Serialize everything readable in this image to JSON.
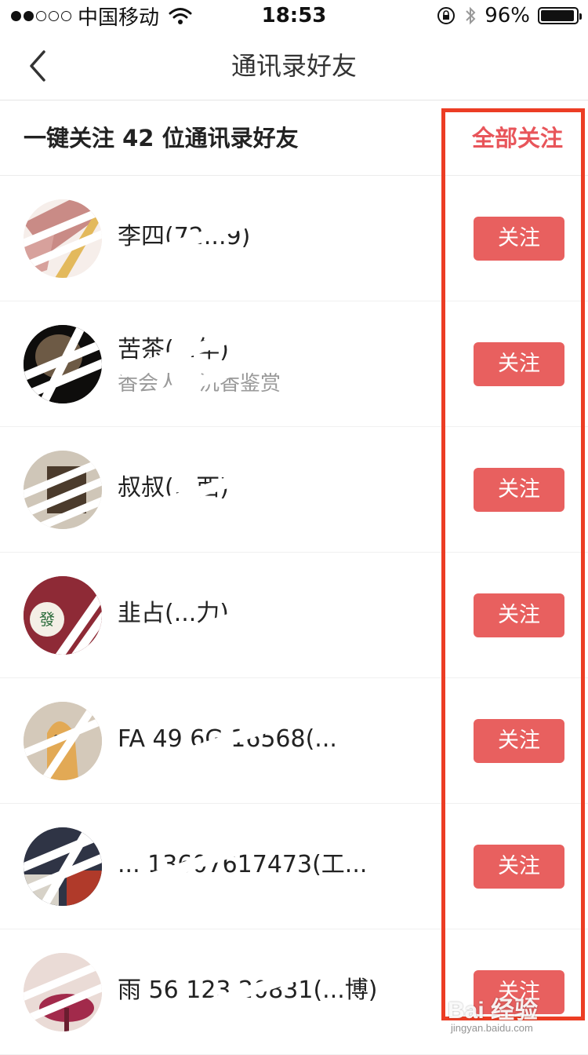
{
  "status_bar": {
    "carrier": "中国移动",
    "time": "18:53",
    "battery": "96%",
    "battery_level": 0.96,
    "signal_bars": 2
  },
  "nav": {
    "title": "通讯录好友",
    "back_icon": "chevron-left-icon"
  },
  "follow_all": {
    "prefix": "一键关注 ",
    "count": "42",
    "suffix": " 位通讯录好友",
    "button": "全部关注"
  },
  "contacts": [
    {
      "name": "李四(72...9)",
      "subtitle": "",
      "follow": "关注"
    },
    {
      "name": "苦茶(...年)",
      "subtitle": "香会人，沉香鉴赏",
      "follow": "关注"
    },
    {
      "name": "叔叔(...西)",
      "subtitle": "",
      "follow": "关注"
    },
    {
      "name": "韭占(...力)",
      "subtitle": "",
      "follow": "关注"
    },
    {
      "name": "FA 49 6G 16568(...",
      "subtitle": "",
      "follow": "关注"
    },
    {
      "name": "... 13607617473(工...",
      "subtitle": "",
      "follow": "关注"
    },
    {
      "name": "雨 56 123 20831(...博)",
      "subtitle": "",
      "follow": "关注"
    }
  ],
  "colors": {
    "accent": "#e8555a",
    "button_bg": "#e8605f",
    "highlight": "#ec3d24"
  },
  "watermark": {
    "logo": "Bai 经验",
    "url": "jingyan.baidu.com"
  }
}
